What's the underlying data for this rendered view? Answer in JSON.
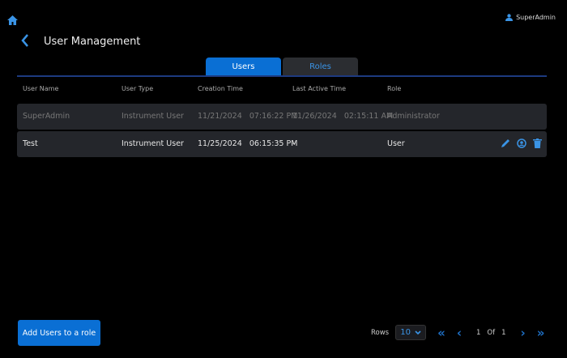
{
  "header": {
    "user": "SuperAdmin",
    "title": "User Management"
  },
  "tabs": [
    {
      "label": "Users",
      "active": true
    },
    {
      "label": "Roles",
      "active": false
    }
  ],
  "columns": [
    "User Name",
    "User Type",
    "Creation Time",
    "Last Active Time",
    "Role"
  ],
  "rows": [
    {
      "name": "SuperAdmin",
      "type": "Instrument User",
      "created": "11/21/2024   07:16:22 PM",
      "last_active": "11/26/2024   02:15:11 AM",
      "role": "Administrator",
      "disabled": true
    },
    {
      "name": "Test",
      "type": "Instrument User",
      "created": "11/25/2024   06:15:35 PM",
      "last_active": "-",
      "role": "User",
      "disabled": false
    }
  ],
  "footer": {
    "add_button": "Add Users to a role",
    "rows_label": "Rows",
    "rows_value": "10",
    "page": "1",
    "of_label": "Of",
    "total_pages": "1"
  },
  "colors": {
    "accent": "#0a6fd4",
    "row_bg": "#24262b"
  }
}
